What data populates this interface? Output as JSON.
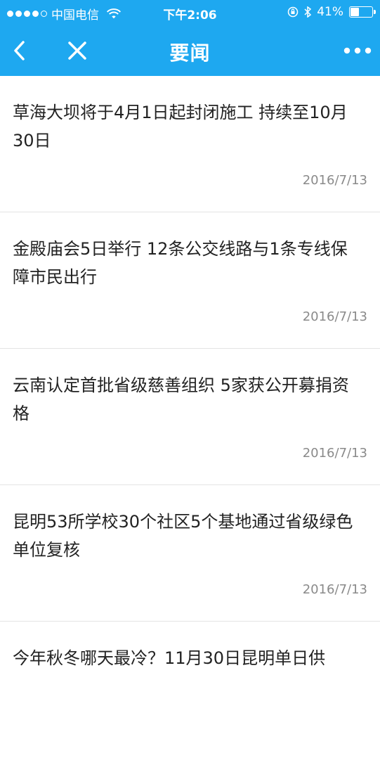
{
  "status": {
    "carrier": "中国电信",
    "time": "下午2:06",
    "battery_text": "41%",
    "battery_level": 0.41
  },
  "nav": {
    "title": "要闻",
    "back_icon": "chevron-left-icon",
    "close_icon": "close-icon",
    "more_icon": "more-dots-icon"
  },
  "news": [
    {
      "title": "草海大坝将于4月1日起封闭施工 持续至10月30日",
      "date": "2016/7/13"
    },
    {
      "title": "金殿庙会5日举行 12条公交线路与1条专线保障市民出行",
      "date": "2016/7/13"
    },
    {
      "title": "云南认定首批省级慈善组织 5家获公开募捐资格",
      "date": "2016/7/13"
    },
    {
      "title": "昆明53所学校30个社区5个基地通过省级绿色单位复核",
      "date": "2016/7/13"
    },
    {
      "title": "今年秋冬哪天最冷？11月30日昆明单日供",
      "date": ""
    }
  ],
  "colors": {
    "header": "#1ea8f0",
    "text": "#222222",
    "date": "#8a8a8a"
  }
}
